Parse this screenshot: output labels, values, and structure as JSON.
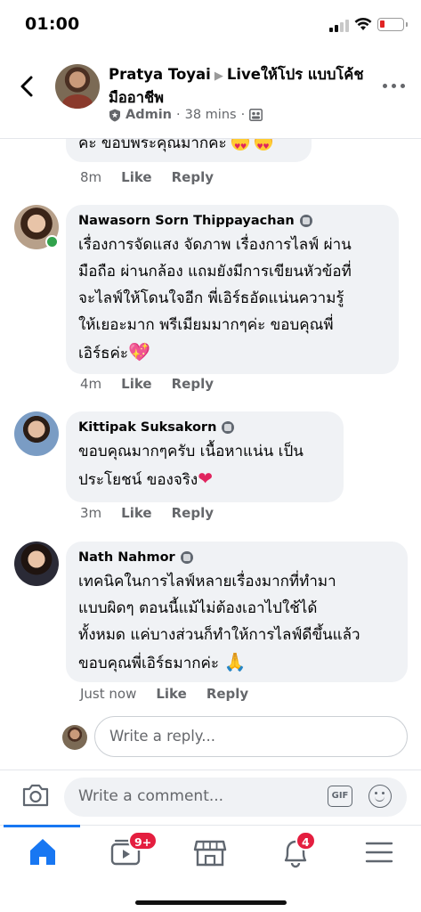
{
  "status_bar": {
    "time": "01:00"
  },
  "header": {
    "title_author": "Pratya Toyai",
    "title_target": "Liveให้โปร แบบโค้ชมืออาชีพ",
    "role": "Admin",
    "time": "38 mins",
    "icons": {
      "back": "back-chevron-icon",
      "shield": "shield-icon",
      "audience": "group-icon",
      "more": "more-icon"
    }
  },
  "comments": [
    {
      "id": "c0",
      "text": "ค่ะ ขอบพระคุณมากค่ะ",
      "emoji": "😍😍",
      "time": "8m",
      "like": "Like",
      "reply": "Reply"
    },
    {
      "id": "c1",
      "name": "Nawasorn Sorn Thippayachan",
      "text_lines": [
        "เรื่องการจัดแสง จัดภาพ เรื่องการไลฟ์ ผ่าน",
        "มือถือ ผ่านกล้อง แถมยังมีการเขียนหัวข้อที่",
        "จะไลฟ์ให้โดนใจอีก พี่เอิร์ธอัดแน่นความรู้",
        "ให้เยอะมาก พรีเมียมมากๆค่ะ ขอบคุณพี่",
        "เอิร์ธค่ะ"
      ],
      "emoji": "💖",
      "time": "4m",
      "like": "Like",
      "reply": "Reply",
      "online": true
    },
    {
      "id": "c2",
      "name": "Kittipak Suksakorn",
      "text_lines": [
        "ขอบคุณมากๆครับ เนื้อหาแน่น เป็น",
        "ประโยชน์ ของจริง"
      ],
      "emoji": "❤",
      "time": "3m",
      "like": "Like",
      "reply": "Reply"
    },
    {
      "id": "c3",
      "name": "Nath Nahmor",
      "text_lines": [
        "เทคนิคในการไลฟ์หลายเรื่องมากที่ทำมา",
        "แบบผิดๆ ตอนนี้แม้ไม่ต้องเอาไปใช้ได้",
        "ทั้งหมด แค่บางส่วนก็ทำให้การไลฟ์ดีขึ้นแล้ว",
        "ขอบคุณพี่เอิร์ธมากค่ะ"
      ],
      "emoji": "🙏",
      "time": "Just now",
      "like": "Like",
      "reply": "Reply"
    }
  ],
  "reply_box": {
    "placeholder": "Write a reply..."
  },
  "composer": {
    "placeholder": "Write a comment...",
    "gif_label": "GIF"
  },
  "bottom_nav": {
    "items": [
      {
        "name": "home",
        "icon": "home-icon",
        "active": true
      },
      {
        "name": "watch",
        "icon": "video-icon",
        "badge": "9+"
      },
      {
        "name": "marketplace",
        "icon": "store-icon"
      },
      {
        "name": "notifications",
        "icon": "bell-icon",
        "badge": "4"
      },
      {
        "name": "menu",
        "icon": "menu-icon"
      }
    ]
  },
  "colors": {
    "accent": "#1877f2",
    "bubble": "#f0f2f5",
    "muted": "#65676b",
    "badge": "#e41e3f",
    "online": "#31a24c"
  }
}
